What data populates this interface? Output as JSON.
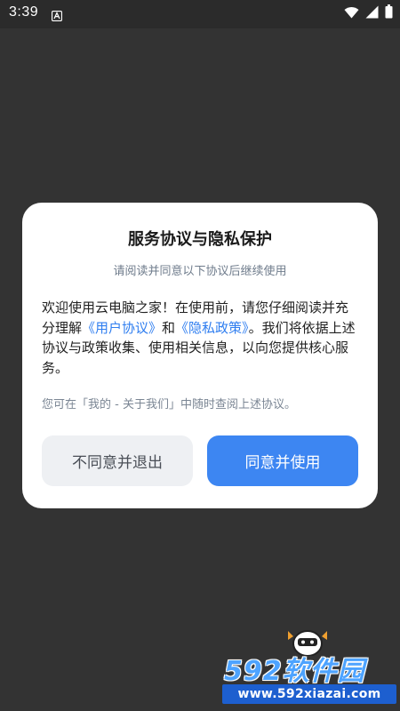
{
  "status_bar": {
    "time": "3:39",
    "icons": [
      "app-notification-icon",
      "wifi-icon",
      "cellular-signal-icon",
      "battery-icon"
    ]
  },
  "dialog": {
    "title": "服务协议与隐私保护",
    "subtitle": "请阅读并同意以下协议后继续使用",
    "body": {
      "text_before": "欢迎使用云电脑之家！在使用前，请您仔细阅读并充分理解",
      "link_user_agreement": "《用户协议》",
      "text_and": "和",
      "link_privacy_policy": "《隐私政策》",
      "text_after": "。我们将依据上述协议与政策收集、使用相关信息，以向您提供核心服务。"
    },
    "note": "您可在「我的 - 关于我们」中随时查阅上述协议。",
    "buttons": {
      "disagree": "不同意并退出",
      "agree": "同意并使用"
    }
  },
  "watermark": {
    "brand": "592软件园",
    "url": "www.592xiazai.com"
  },
  "colors": {
    "background": "#333333",
    "dialog": "#ffffff",
    "accent": "#3d86f2",
    "link": "#2f7ef0"
  }
}
